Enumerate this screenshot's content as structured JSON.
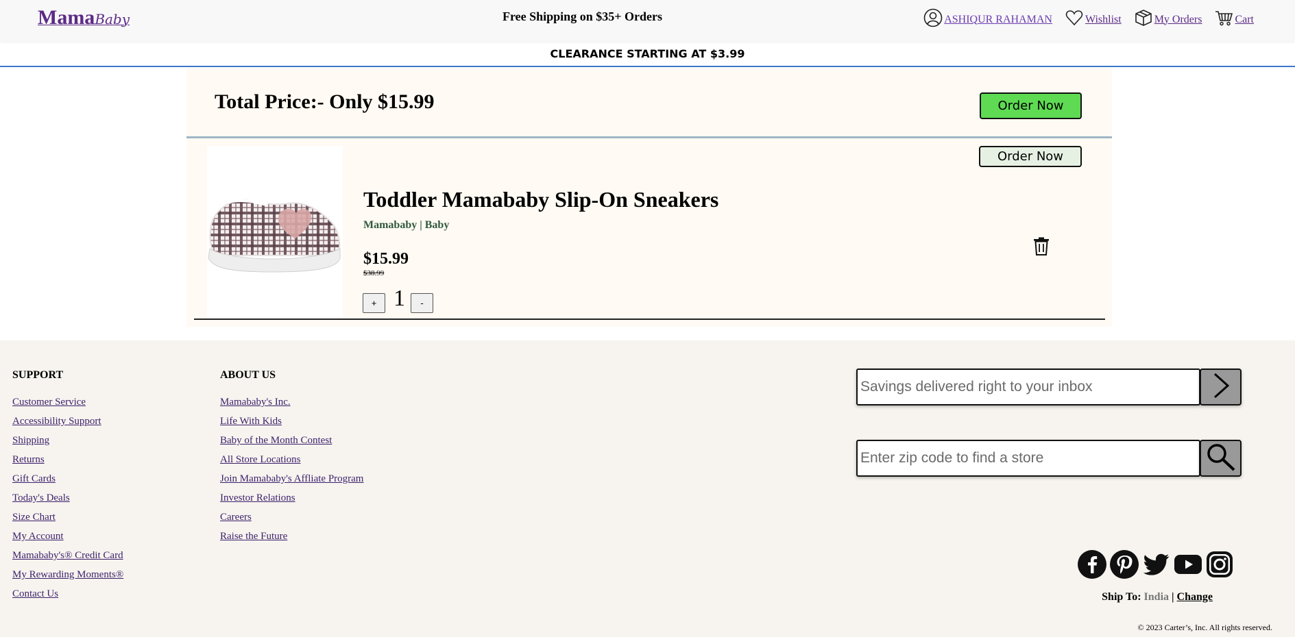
{
  "header": {
    "logo_main": "Mama",
    "logo_sub": "Baby",
    "promo": "Free Shipping on $35+ Orders",
    "nav": {
      "user": "ASHIQUR RAHAMAN",
      "wishlist": "Wishlist",
      "orders": "My Orders",
      "cart": "Cart"
    },
    "clearance": "CLEARANCE STARTING AT $3.99"
  },
  "cart": {
    "total_label": "Total Price:- Only $15.99",
    "order_button": "Order Now",
    "item": {
      "title": "Toddler Mamababy Slip-On Sneakers",
      "brand": "Mamababy | Baby",
      "price": "$15.99",
      "old_price": "$38.99",
      "quantity": "1",
      "plus": "+",
      "minus": "-",
      "order_button": "Order Now",
      "image_icon": "plaid-slip-on-sneaker-image"
    }
  },
  "footer": {
    "support_title": "SUPPORT",
    "support_links": [
      "Customer Service",
      "Accessibility Support",
      "Shipping",
      "Returns",
      "Gift Cards",
      "Today's Deals",
      "Size Chart",
      "My Account",
      "Mamababy's® Credit Card",
      "My Rewarding Moments®",
      "Contact Us"
    ],
    "about_title": "ABOUT US",
    "about_links": [
      "Mamababy's Inc.",
      "Life With Kids",
      "Baby of the Month Contest",
      "All Store Locations",
      "Join Mamababy's Affliate Program",
      "Investor Relations",
      "Careers",
      "Raise the Future"
    ],
    "newsletter_placeholder": "Savings delivered right to your inbox",
    "zip_placeholder": "Enter zip code to find a store",
    "social_icons": [
      "facebook-icon",
      "pinterest-icon",
      "twitter-icon",
      "youtube-icon",
      "instagram-icon"
    ],
    "ship_to_label": "Ship To:",
    "ship_to_country": "India",
    "ship_to_sep": "|",
    "ship_to_change": "Change",
    "copyright": "© 2023 Carter’s, Inc. All rights reserved."
  },
  "colors": {
    "brand_purple": "#5b2a86",
    "order_green": "#5edb52",
    "cart_bg": "#fffaf3",
    "footer_bg": "#f7f4ef"
  }
}
